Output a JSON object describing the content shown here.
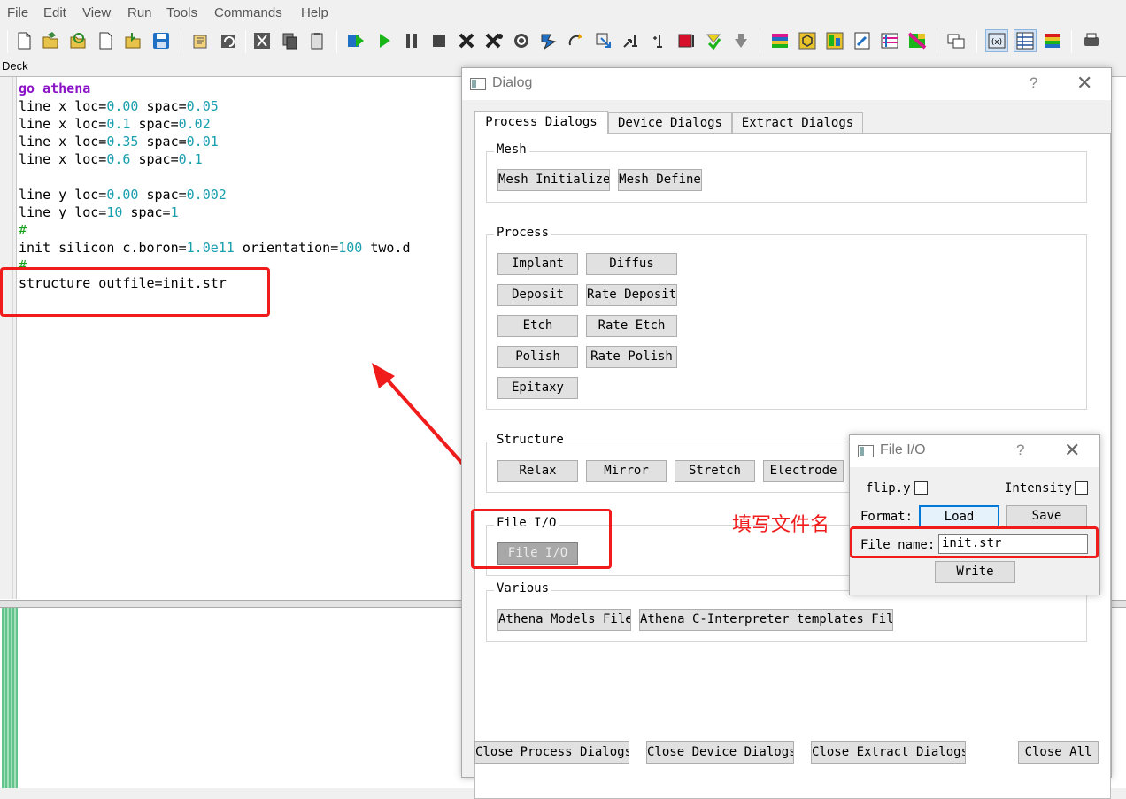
{
  "menu": [
    "File",
    "Edit",
    "View",
    "Run",
    "Tools",
    "Commands",
    "Help"
  ],
  "toolbar_icons": [
    "new-file-icon",
    "open-file-icon",
    "reload-file-icon",
    "new-document-icon",
    "import-icon",
    "save-icon",
    "copy-doc-icon",
    "undo-icon",
    "cut-icon",
    "copy-icon",
    "paste-icon",
    "run-deck-icon",
    "play-icon",
    "pause-icon",
    "stop-icon",
    "kill-icon",
    "kill-all-icon",
    "restart-icon",
    "step-icon",
    "step-over-icon",
    "line-step-icon",
    "add-line-icon",
    "insert-line-icon",
    "breakpoint-icon",
    "clear-icon",
    "options-icon",
    "tonyplot-icon",
    "devedit-icon",
    "maskviews-icon",
    "deckbuild-icon",
    "palette-icon",
    "color-grid-icon",
    "windows-icon",
    "variables-icon",
    "table-icon",
    "gradient-icon",
    "print-icon"
  ],
  "deck_label": "Deck",
  "editor_lines": [
    [
      {
        "t": "go athena",
        "c": "kw"
      }
    ],
    [
      {
        "t": "line x loc=",
        "c": "txt"
      },
      {
        "t": "0.00",
        "c": "num"
      },
      {
        "t": " spac=",
        "c": "txt"
      },
      {
        "t": "0.05",
        "c": "num"
      }
    ],
    [
      {
        "t": "line x loc=",
        "c": "txt"
      },
      {
        "t": "0.1",
        "c": "num"
      },
      {
        "t": " spac=",
        "c": "txt"
      },
      {
        "t": "0.02",
        "c": "num"
      }
    ],
    [
      {
        "t": "line x loc=",
        "c": "txt"
      },
      {
        "t": "0.35",
        "c": "num"
      },
      {
        "t": " spac=",
        "c": "txt"
      },
      {
        "t": "0.01",
        "c": "num"
      }
    ],
    [
      {
        "t": "line x loc=",
        "c": "txt"
      },
      {
        "t": "0.6",
        "c": "num"
      },
      {
        "t": " spac=",
        "c": "txt"
      },
      {
        "t": "0.1",
        "c": "num"
      }
    ],
    [],
    [
      {
        "t": "line y loc=",
        "c": "txt"
      },
      {
        "t": "0.00",
        "c": "num"
      },
      {
        "t": " spac=",
        "c": "txt"
      },
      {
        "t": "0.002",
        "c": "num"
      }
    ],
    [
      {
        "t": "line y loc=",
        "c": "txt"
      },
      {
        "t": "10",
        "c": "num"
      },
      {
        "t": " spac=",
        "c": "txt"
      },
      {
        "t": "1",
        "c": "num"
      }
    ],
    [
      {
        "t": "#",
        "c": "cmt"
      }
    ],
    [
      {
        "t": "init silicon c.boron=",
        "c": "txt"
      },
      {
        "t": "1.0e11",
        "c": "num"
      },
      {
        "t": " orientation=",
        "c": "txt"
      },
      {
        "t": "100",
        "c": "num"
      },
      {
        "t": " two.d",
        "c": "txt"
      }
    ],
    [
      {
        "t": "#",
        "c": "cmt"
      }
    ],
    [
      {
        "t": "structure outfile=init.str",
        "c": "txt"
      }
    ]
  ],
  "annotation": "填写文件名",
  "dialog": {
    "title": "Dialog",
    "help": "?",
    "close": "✕",
    "tabs": [
      "Process Dialogs",
      "Device Dialogs",
      "Extract Dialogs"
    ],
    "mesh": {
      "title": "Mesh",
      "buttons": [
        "Mesh Initialize",
        "Mesh Define"
      ]
    },
    "process": {
      "title": "Process",
      "buttons": [
        "Implant",
        "Diffus",
        "Deposit",
        "Rate Deposit",
        "Etch",
        "Rate Etch",
        "Polish",
        "Rate Polish",
        "Epitaxy"
      ]
    },
    "structure": {
      "title": "Structure",
      "buttons": [
        "Relax",
        "Mirror",
        "Stretch",
        "Electrode"
      ]
    },
    "fileio": {
      "title": "File I/O",
      "button": "File I/O"
    },
    "various": {
      "title": "Various",
      "buttons": [
        "Athena Models File",
        "Athena C-Interpreter templates File"
      ]
    },
    "footer": [
      "Close Process Dialogs",
      "Close Device Dialogs",
      "Close Extract Dialogs",
      "Close All"
    ]
  },
  "fileio_dialog": {
    "title": "File I/O",
    "help": "?",
    "close": "✕",
    "flip_label": "flip.y",
    "intensity_label": "Intensity",
    "format_label": "Format:",
    "load": "Load",
    "save": "Save",
    "filename_label": "File name:",
    "filename_value": "init.str",
    "write": "Write"
  },
  "colors": {
    "accent_red": "#f01c1c",
    "keyword": "#8b14c8",
    "number": "#1a9fae",
    "comment": "#1aa01a",
    "focus_blue": "#0078d7"
  }
}
